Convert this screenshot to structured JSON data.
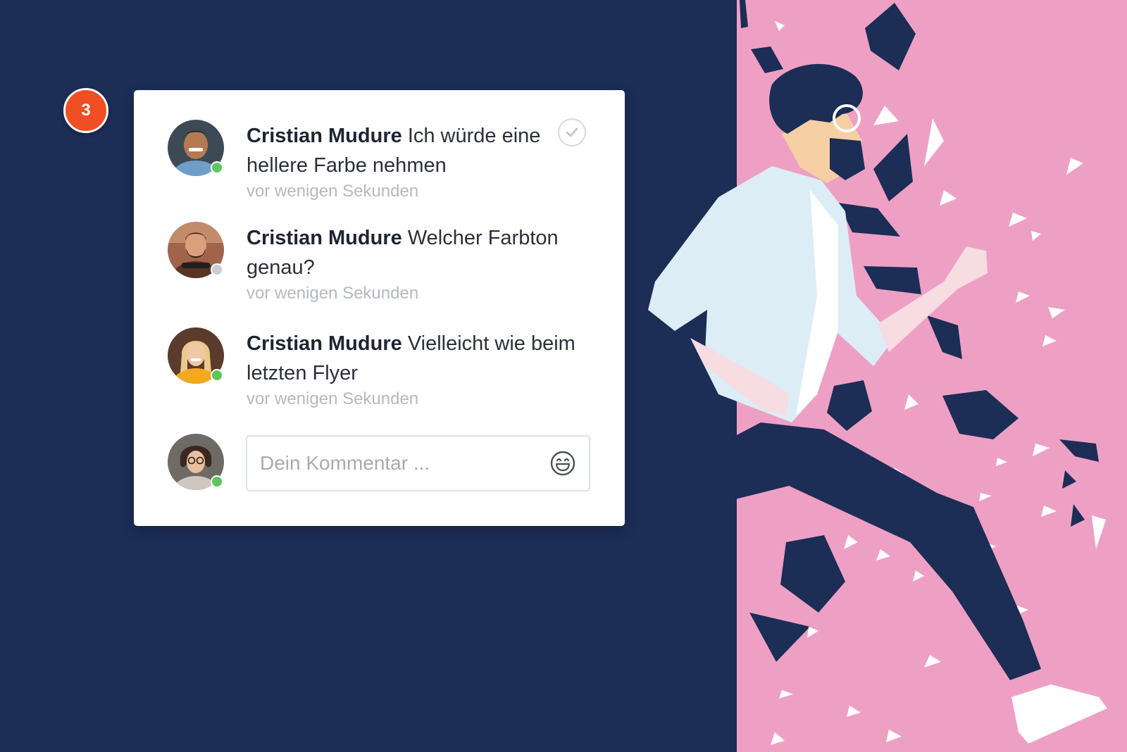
{
  "colors": {
    "background": "#1c2d56",
    "accent_pink": "#eea0c4",
    "badge": "#f04e23",
    "online": "#5cc85a",
    "offline": "#c9ccd1"
  },
  "badge": {
    "count": "3"
  },
  "comments": [
    {
      "author": "Cristian Mudure",
      "text": "Ich würde eine hellere Farbe nehmen",
      "time": "vor wenigen Sekunden",
      "status": "online",
      "avatar_icon": "man-smiling-avatar"
    },
    {
      "author": "Cristian Mudure",
      "text": "Welcher Farbton genau?",
      "time": "vor wenigen Sekunden",
      "status": "offline",
      "avatar_icon": "man-beard-avatar"
    },
    {
      "author": "Cristian Mudure",
      "text": "Vielleicht wie beim letzten Flyer",
      "time": "vor wenigen Sekunden",
      "status": "online",
      "avatar_icon": "woman-blonde-avatar"
    }
  ],
  "composer": {
    "placeholder": "Dein Kommentar ...",
    "value": "",
    "avatar_icon": "woman-glasses-avatar",
    "status": "online"
  },
  "icons": {
    "resolve": "check-icon",
    "emoji": "smiley-icon"
  }
}
